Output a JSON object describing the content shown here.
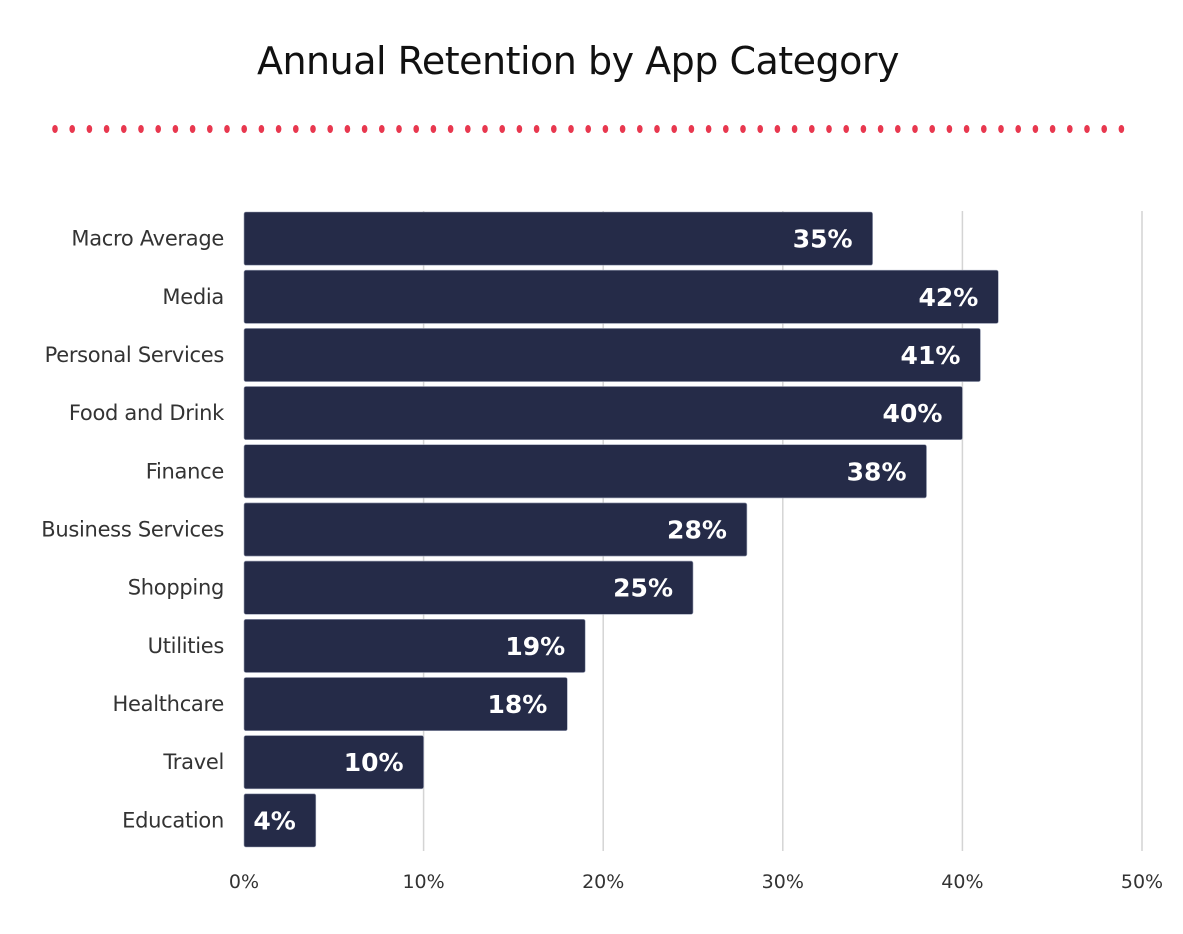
{
  "chart_data": {
    "type": "bar",
    "orientation": "horizontal",
    "title": "Annual Retention by App Category",
    "xlabel": "",
    "ylabel": "",
    "categories": [
      "Macro Average",
      "Media",
      "Personal Services",
      "Food and Drink",
      "Finance",
      "Business Services",
      "Shopping",
      "Utilities",
      "Healthcare",
      "Travel",
      "Education"
    ],
    "values": [
      35,
      42,
      41,
      40,
      38,
      28,
      25,
      19,
      18,
      10,
      4
    ],
    "data_labels": [
      "35%",
      "42%",
      "41%",
      "40%",
      "38%",
      "28%",
      "25%",
      "19%",
      "18%",
      "10%",
      "4%"
    ],
    "xlim": [
      0,
      50
    ],
    "x_ticks": [
      0,
      10,
      20,
      30,
      40,
      50
    ],
    "x_tick_labels": [
      "0%",
      "10%",
      "20%",
      "30%",
      "40%",
      "50%"
    ],
    "grid": "vertical",
    "legend": "none",
    "colors": {
      "bar": "#252b48",
      "divider_dots": "#e8384f",
      "label_text": "#ffffff"
    }
  }
}
